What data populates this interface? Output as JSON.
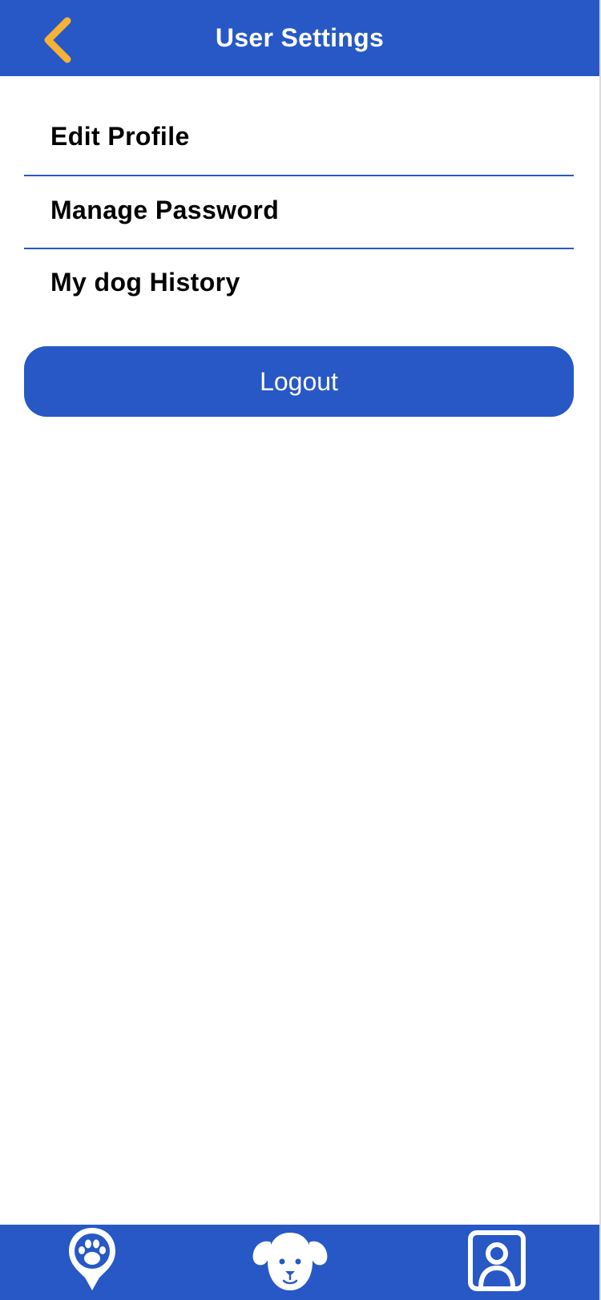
{
  "header": {
    "title": "User Settings",
    "back_icon": "chevron-left-icon"
  },
  "menu": {
    "items": [
      {
        "label": "Edit Profile"
      },
      {
        "label": "Manage Password"
      },
      {
        "label": "My dog History"
      }
    ]
  },
  "logout": {
    "label": "Logout"
  },
  "bottom_nav": {
    "items": [
      {
        "icon": "paw-location-pin-icon"
      },
      {
        "icon": "dog-face-icon"
      },
      {
        "icon": "user-profile-icon"
      }
    ]
  },
  "colors": {
    "primary": "#2758c6",
    "accent": "#f5b335",
    "text": "#000000",
    "on_primary": "#ffffff"
  }
}
